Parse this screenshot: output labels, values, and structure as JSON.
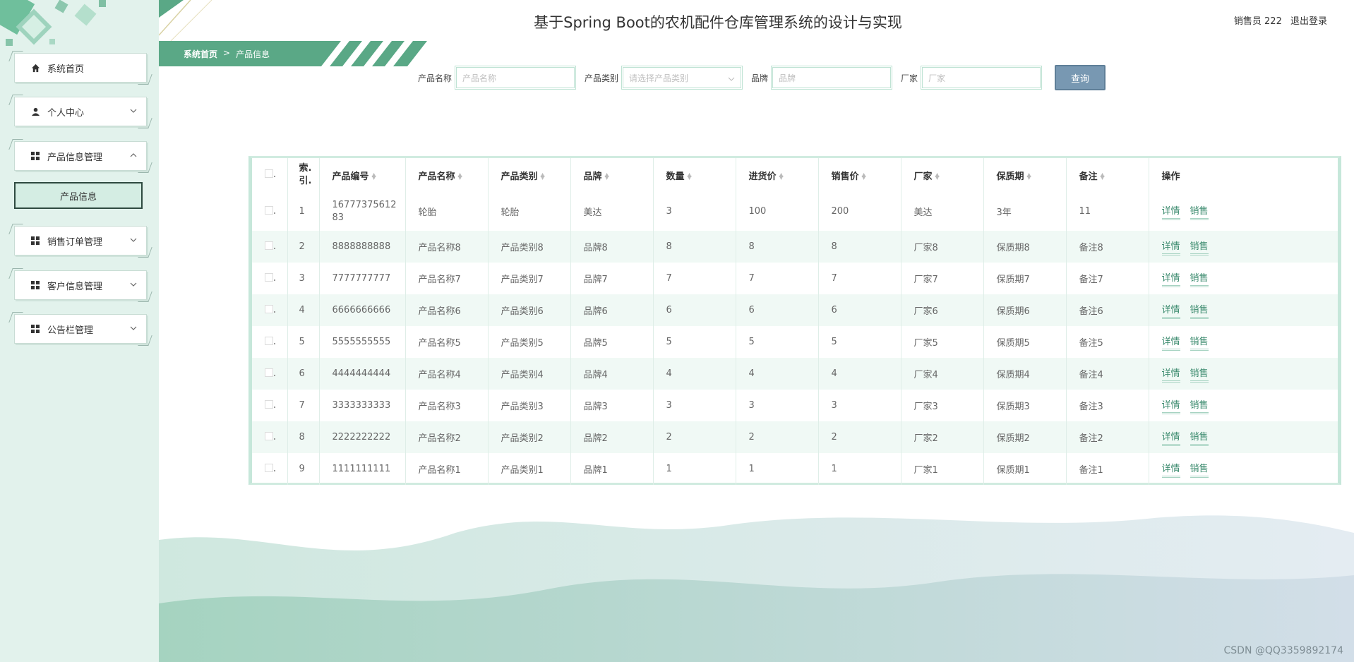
{
  "header": {
    "title": "基于Spring Boot的农机配件仓库管理系统的设计与实现",
    "user_label": "销售员 222",
    "logout_label": "退出登录"
  },
  "sidebar": {
    "items": [
      {
        "label": "系统首页",
        "icon": "home-icon"
      },
      {
        "label": "个人中心",
        "icon": "user-icon"
      },
      {
        "label": "产品信息管理",
        "icon": "grid-icon"
      },
      {
        "label": "销售订单管理",
        "icon": "grid-icon"
      },
      {
        "label": "客户信息管理",
        "icon": "grid-icon"
      },
      {
        "label": "公告栏管理",
        "icon": "grid-icon"
      }
    ],
    "sub_item": "产品信息"
  },
  "breadcrumb": {
    "home": "系统首页",
    "separator": ">",
    "current": "产品信息"
  },
  "search": {
    "name_label": "产品名称",
    "name_placeholder": "产品名称",
    "category_label": "产品类别",
    "category_placeholder": "请选择产品类别",
    "brand_label": "品牌",
    "brand_placeholder": "品牌",
    "maker_label": "厂家",
    "maker_placeholder": "厂家",
    "button": "查询"
  },
  "table": {
    "columns": [
      "索引",
      "产品编号",
      "产品名称",
      "产品类别",
      "品牌",
      "数量",
      "进货价",
      "销售价",
      "厂家",
      "保质期",
      "备注",
      "操作"
    ],
    "index_header_line1": "索.",
    "index_header_line2": "引.",
    "rows": [
      {
        "idx": "1",
        "code": "1677737561283",
        "code_l1": "16777375612",
        "code_l2": "83",
        "name": "轮胎",
        "cat": "轮胎",
        "brand": "美达",
        "qty": "3",
        "buy": "100",
        "sell": "200",
        "maker": "美达",
        "shelf": "3年",
        "note": "11"
      },
      {
        "idx": "2",
        "code": "8888888888",
        "name": "产品名称8",
        "cat": "产品类别8",
        "brand": "品牌8",
        "qty": "8",
        "buy": "8",
        "sell": "8",
        "maker": "厂家8",
        "shelf": "保质期8",
        "note": "备注8"
      },
      {
        "idx": "3",
        "code": "7777777777",
        "name": "产品名称7",
        "cat": "产品类别7",
        "brand": "品牌7",
        "qty": "7",
        "buy": "7",
        "sell": "7",
        "maker": "厂家7",
        "shelf": "保质期7",
        "note": "备注7"
      },
      {
        "idx": "4",
        "code": "6666666666",
        "name": "产品名称6",
        "cat": "产品类别6",
        "brand": "品牌6",
        "qty": "6",
        "buy": "6",
        "sell": "6",
        "maker": "厂家6",
        "shelf": "保质期6",
        "note": "备注6"
      },
      {
        "idx": "5",
        "code": "5555555555",
        "name": "产品名称5",
        "cat": "产品类别5",
        "brand": "品牌5",
        "qty": "5",
        "buy": "5",
        "sell": "5",
        "maker": "厂家5",
        "shelf": "保质期5",
        "note": "备注5"
      },
      {
        "idx": "6",
        "code": "4444444444",
        "name": "产品名称4",
        "cat": "产品类别4",
        "brand": "品牌4",
        "qty": "4",
        "buy": "4",
        "sell": "4",
        "maker": "厂家4",
        "shelf": "保质期4",
        "note": "备注4"
      },
      {
        "idx": "7",
        "code": "3333333333",
        "name": "产品名称3",
        "cat": "产品类别3",
        "brand": "品牌3",
        "qty": "3",
        "buy": "3",
        "sell": "3",
        "maker": "厂家3",
        "shelf": "保质期3",
        "note": "备注3"
      },
      {
        "idx": "8",
        "code": "2222222222",
        "name": "产品名称2",
        "cat": "产品类别2",
        "brand": "品牌2",
        "qty": "2",
        "buy": "2",
        "sell": "2",
        "maker": "厂家2",
        "shelf": "保质期2",
        "note": "备注2"
      },
      {
        "idx": "9",
        "code": "1111111111",
        "name": "产品名称1",
        "cat": "产品类别1",
        "brand": "品牌1",
        "qty": "1",
        "buy": "1",
        "sell": "1",
        "maker": "厂家1",
        "shelf": "保质期1",
        "note": "备注1"
      }
    ],
    "detail_label": "详情",
    "sell_label": "销售"
  },
  "watermark": "CSDN @QQ3359892174",
  "colors": {
    "sidebar_bg": "#e2f2ec",
    "accent": "#5aa886",
    "row_alt": "#f0f9f5",
    "button": "#7898b2",
    "link": "#3a8a6d"
  }
}
